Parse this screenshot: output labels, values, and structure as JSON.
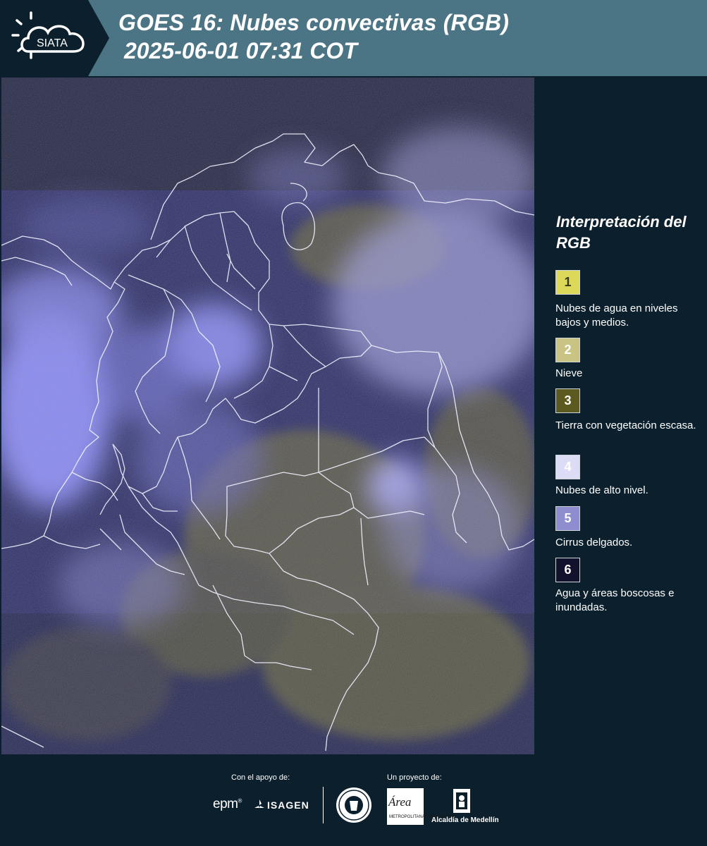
{
  "header": {
    "title_line1": "GOES 16: Nubes convectivas (RGB)",
    "title_line2": "2025-06-01 07:31 COT",
    "logo_text": "SIATA"
  },
  "map": {
    "description_icon": "satellite-rgb-image"
  },
  "legend": {
    "title": "Interpretación del RGB",
    "items": [
      {
        "number": "1",
        "label": "Nubes de agua en niveles bajos y medios.",
        "color": "#dcd85a",
        "text_color": "#3a3a1a"
      },
      {
        "number": "2",
        "label": "Nieve",
        "color": "#c9c483",
        "text_color": "#ffffff"
      },
      {
        "number": "3",
        "label": "Tierra con vegetación escasa.",
        "color": "#5c5a1e",
        "text_color": "#ffffff"
      },
      {
        "number": "4",
        "label": "Nubes de alto nivel.",
        "color": "#dcdcf6",
        "text_color": "#ffffff"
      },
      {
        "number": "5",
        "label": "Cirrus delgados.",
        "color": "#8d8dd0",
        "text_color": "#ffffff"
      },
      {
        "number": "6",
        "label": "Agua y áreas boscosas e inundadas.",
        "color": "#12122c",
        "text_color": "#ffffff"
      }
    ]
  },
  "footer": {
    "support_label": "Con el apoyo de:",
    "project_label": "Un proyecto de:",
    "epm": "epm",
    "isagen": "ISAGEN",
    "area_word": "Área",
    "area_sub": "METROPOLITANA Valle de Aburrá",
    "alcaldia": "Alcaldía de Medellín"
  }
}
